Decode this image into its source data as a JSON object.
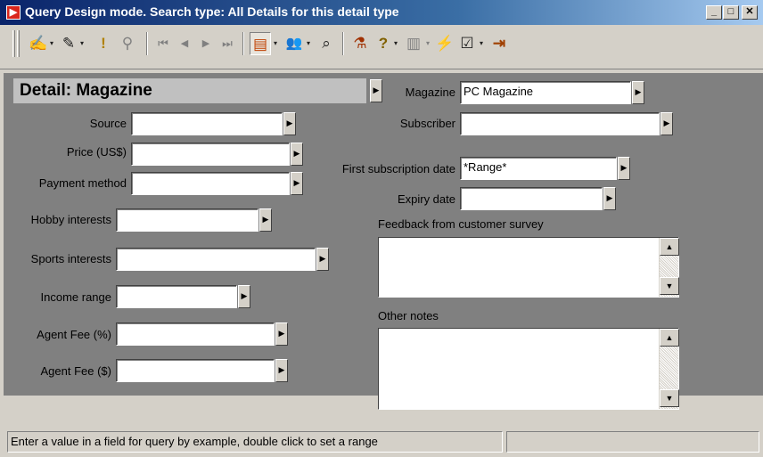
{
  "window": {
    "title": "Query Design mode. Search type: All Details for this detail type",
    "app_icon_glyph": "▶",
    "minimize": "_",
    "maximize": "□",
    "close": "✕"
  },
  "toolbar": {
    "icons": [
      {
        "name": "design-edit-icon",
        "glyph": "✍"
      },
      {
        "name": "dropdown-arrow-icon",
        "glyph": "▾"
      },
      {
        "name": "clear-query-icon",
        "glyph": "✎"
      },
      {
        "name": "dropdown-arrow-icon-2",
        "glyph": "▾"
      },
      {
        "name": "exclamation-icon",
        "glyph": "!"
      },
      {
        "name": "pin-icon",
        "glyph": "⚲"
      },
      {
        "name": "first-record-icon",
        "glyph": "⏮"
      },
      {
        "name": "previous-record-icon",
        "glyph": "◀"
      },
      {
        "name": "next-record-icon",
        "glyph": "▶"
      },
      {
        "name": "last-record-icon",
        "glyph": "⏭"
      },
      {
        "name": "form-view-icon",
        "glyph": "▤"
      },
      {
        "name": "dropdown-arrow-icon-3",
        "glyph": "▾"
      },
      {
        "name": "people-icon",
        "glyph": "👥"
      },
      {
        "name": "dropdown-arrow-icon-4",
        "glyph": "▾"
      },
      {
        "name": "lookup-icon",
        "glyph": "⌕"
      },
      {
        "name": "query-run-icon",
        "glyph": "⚗"
      },
      {
        "name": "help-icon",
        "glyph": "?"
      },
      {
        "name": "dropdown-arrow-icon-5",
        "glyph": "▾"
      },
      {
        "name": "document-icon",
        "glyph": "▥"
      },
      {
        "name": "dropdown-arrow-icon-6",
        "glyph": "▾"
      },
      {
        "name": "lightning-icon",
        "glyph": "⚡"
      },
      {
        "name": "properties-icon",
        "glyph": "☑"
      },
      {
        "name": "dropdown-arrow-icon-7",
        "glyph": "▾"
      },
      {
        "name": "exit-icon",
        "glyph": "⇥"
      }
    ]
  },
  "detail": {
    "prefix": "Detail:",
    "name": "Magazine"
  },
  "fields": {
    "source": {
      "label": "Source",
      "value": ""
    },
    "price": {
      "label": "Price (US$)",
      "value": ""
    },
    "payment_method": {
      "label": "Payment method",
      "value": ""
    },
    "hobby_interests": {
      "label": "Hobby interests",
      "value": ""
    },
    "sports_interests": {
      "label": "Sports interests",
      "value": ""
    },
    "income_range": {
      "label": "Income range",
      "value": ""
    },
    "agent_fee_pct": {
      "label": "Agent Fee (%)",
      "value": ""
    },
    "agent_fee_usd": {
      "label": "Agent Fee ($)",
      "value": ""
    },
    "magazine": {
      "label": "Magazine",
      "value": "PC Magazine"
    },
    "subscriber": {
      "label": "Subscriber",
      "value": ""
    },
    "first_subscription_date": {
      "label": "First subscription date",
      "value": "*Range*"
    },
    "expiry_date": {
      "label": "Expiry date",
      "value": ""
    },
    "feedback": {
      "label": "Feedback from customer survey",
      "value": ""
    },
    "other_notes": {
      "label": "Other notes",
      "value": ""
    }
  },
  "arrow_glyph": "▶",
  "scroll": {
    "up": "▲",
    "down": "▼"
  },
  "status": {
    "message": "Enter a value in a field for query by example, double click to set a range"
  }
}
